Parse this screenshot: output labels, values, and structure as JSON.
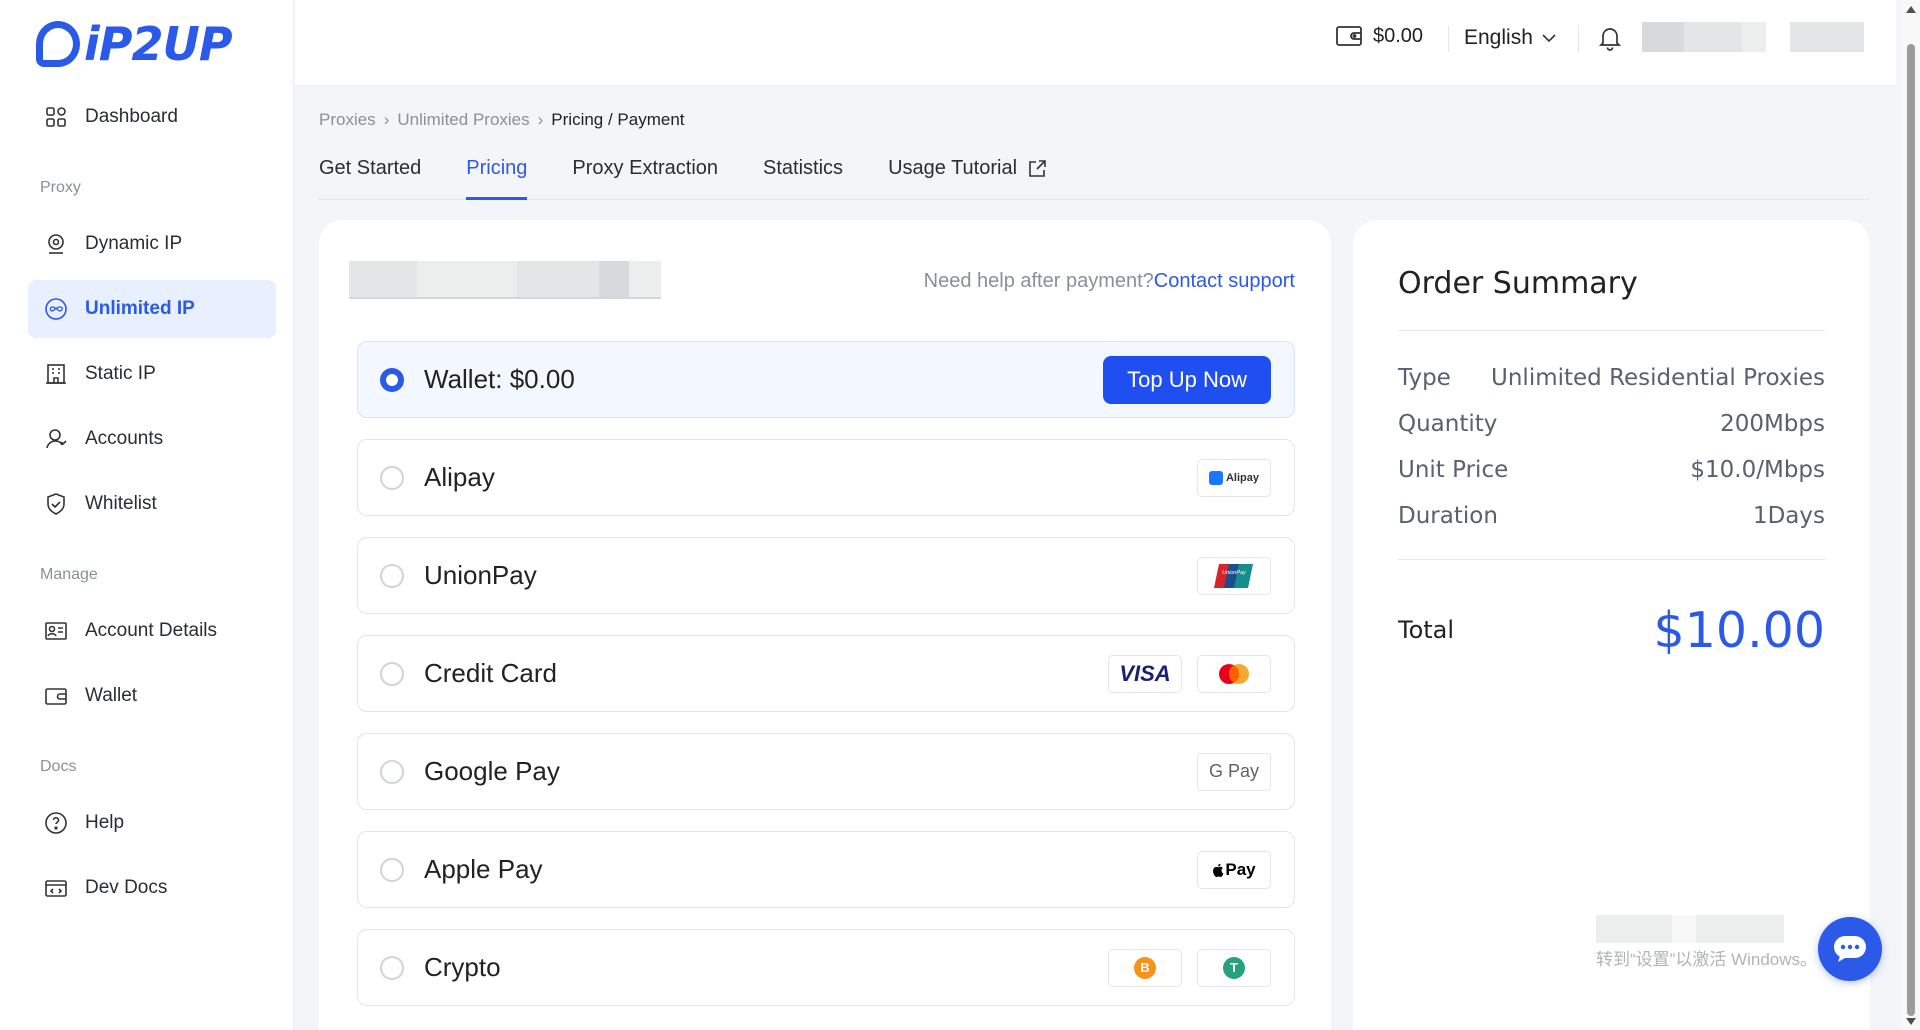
{
  "brand": {
    "logo_text": "iP2UP"
  },
  "header": {
    "wallet_balance": "$0.00",
    "language": "English"
  },
  "sidebar": {
    "items": [
      {
        "label": "Dashboard"
      },
      {
        "section": "Proxy"
      },
      {
        "label": "Dynamic IP"
      },
      {
        "label": "Unlimited IP",
        "active": true
      },
      {
        "label": "Static IP"
      },
      {
        "label": "Accounts"
      },
      {
        "label": "Whitelist"
      },
      {
        "section": "Manage"
      },
      {
        "label": "Account Details"
      },
      {
        "label": "Wallet"
      },
      {
        "section": "Docs"
      },
      {
        "label": "Help"
      },
      {
        "label": "Dev Docs"
      }
    ]
  },
  "breadcrumb": {
    "items": [
      "Proxies",
      "Unlimited Proxies",
      "Pricing / Payment"
    ]
  },
  "tabs": [
    {
      "label": "Get Started"
    },
    {
      "label": "Pricing",
      "active": true
    },
    {
      "label": "Proxy Extraction"
    },
    {
      "label": "Statistics"
    },
    {
      "label": "Usage Tutorial"
    }
  ],
  "payment": {
    "help_text": "Need help after payment?",
    "help_link": "Contact support",
    "topup_label": "Top Up Now",
    "methods": [
      {
        "label": "Wallet: $0.00",
        "selected": true
      },
      {
        "label": "Alipay",
        "badges": [
          "Alipay"
        ]
      },
      {
        "label": "UnionPay",
        "badges": [
          "UnionPay 银联"
        ]
      },
      {
        "label": "Credit Card",
        "badges": [
          "VISA",
          "mastercard"
        ]
      },
      {
        "label": "Google Pay",
        "badges": [
          "G Pay"
        ]
      },
      {
        "label": "Apple Pay",
        "badges": [
          "Pay"
        ]
      },
      {
        "label": "Crypto",
        "badges": [
          "B",
          "T"
        ]
      }
    ]
  },
  "summary": {
    "title": "Order Summary",
    "rows": [
      {
        "label": "Type",
        "value": "Unlimited Residential Proxies"
      },
      {
        "label": "Quantity",
        "value": "200Mbps"
      },
      {
        "label": "Unit Price",
        "value": "$10.0/Mbps"
      },
      {
        "label": "Duration",
        "value": "1Days"
      }
    ],
    "total_label": "Total",
    "total_value": "$10.00"
  },
  "watermark": "转到“设置”以激活 Windows。",
  "colors": {
    "accent": "#2b59e8",
    "button": "#1f4ff0"
  }
}
